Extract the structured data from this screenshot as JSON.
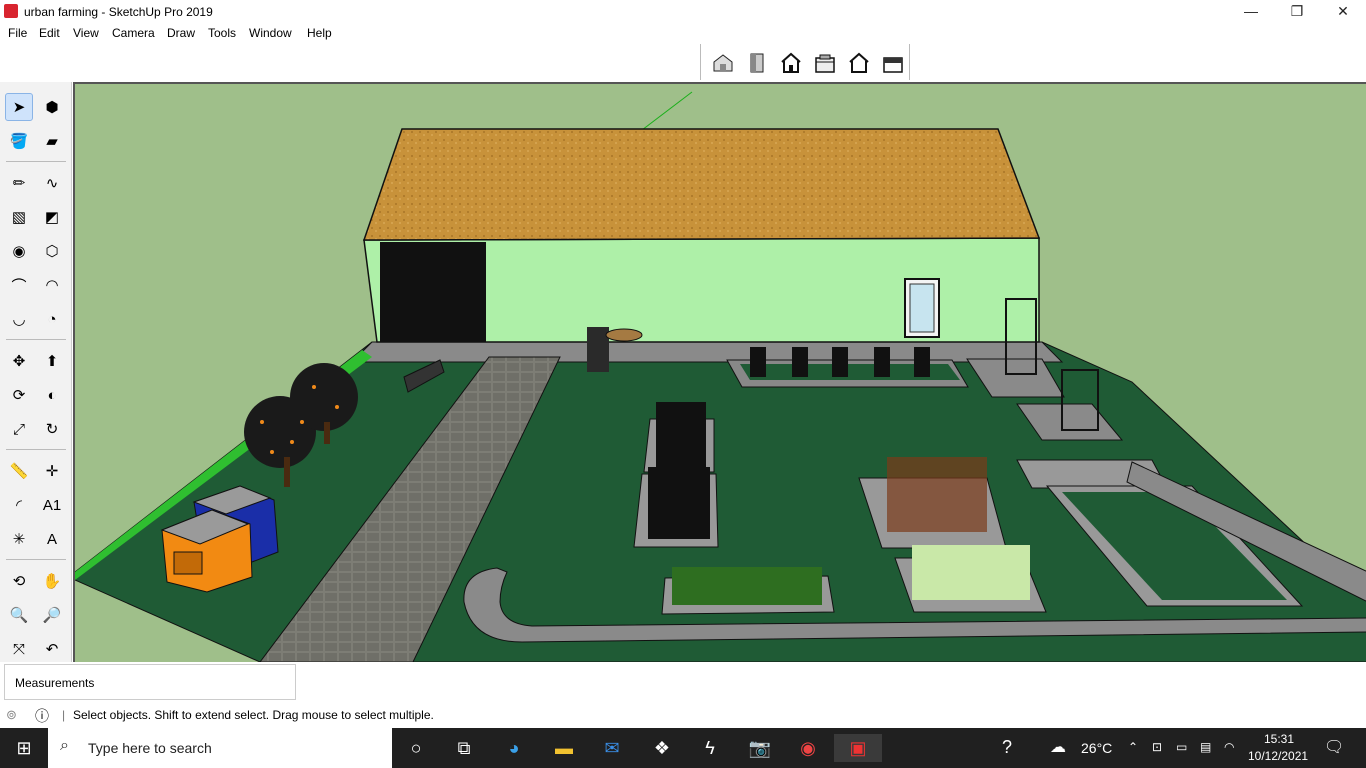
{
  "window": {
    "title": "urban farming - SketchUp Pro 2019",
    "minimize": "—",
    "restore": "❐",
    "close": "✕"
  },
  "menu": [
    "File",
    "Edit",
    "View",
    "Camera",
    "Draw",
    "Tools",
    "Window",
    "Help"
  ],
  "measurements": {
    "label": "Measurements",
    "value": ""
  },
  "status": {
    "text": "Select objects. Shift to extend select. Drag mouse to select multiple."
  },
  "taskbar": {
    "search_placeholder": "Type here to search",
    "weather": "26°C",
    "time": "15:31",
    "date": "10/12/2021"
  },
  "colors": {
    "grass": "#1f5b35",
    "sky": "#9fbf8a",
    "wall": "#aef0a8",
    "roof": "#c8923a",
    "path": "#6e6e66",
    "taskbar": "#202020"
  }
}
